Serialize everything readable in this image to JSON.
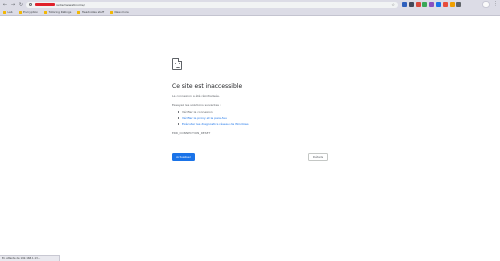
{
  "browser": {
    "url_suffix": "rediemsiwetinome/",
    "bookmarks": [
      {
        "label": "Lab",
        "icon_color": "#f2b705"
      },
      {
        "label": "Encryption",
        "icon_color": "#f2b705"
      },
      {
        "label": "Tutoring Ratings",
        "icon_color": "#f2b705"
      },
      {
        "label": "Headnotes stuff",
        "icon_color": "#f2b705"
      },
      {
        "label": "New more",
        "icon_color": "#f2b705"
      }
    ],
    "extension_colors": [
      "#2e5fbd",
      "#444a5a",
      "#d94a3d",
      "#3aa757",
      "#8a4fc0",
      "#1a73e8",
      "#e74c3c",
      "#f1a000",
      "#5f6368"
    ],
    "icons": {
      "back": "←",
      "forward": "→",
      "reload": "↻",
      "star": "☆",
      "menu": "⋮"
    }
  },
  "error_page": {
    "title": "Ce site est inaccessible",
    "subtitle": "La connexion a été réinitialisée.",
    "try_label": "Essayez les solutions suivantes :",
    "suggestions": [
      {
        "text": "Vérifier la connexion",
        "link": false
      },
      {
        "text": "Vérifier le proxy et le pare-feu",
        "link": true
      },
      {
        "text": "Exécuter les diagnostics réseau de Windows",
        "link": true
      }
    ],
    "error_code": "ERR_CONNECTION_RESET",
    "reload_label": "Actualiser",
    "details_label": "Détails"
  },
  "status_bar": {
    "text": "En attente de 192.168.1.13..."
  },
  "colors": {
    "accent": "#1a73e8",
    "chrome": "#dcdce6",
    "url_redaction": "#e0212a"
  }
}
